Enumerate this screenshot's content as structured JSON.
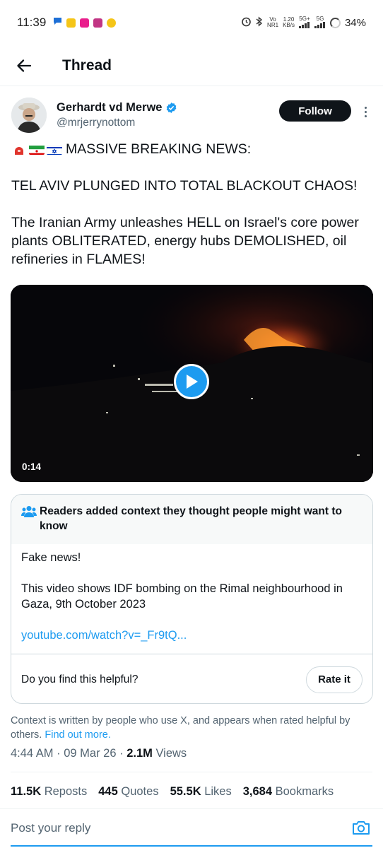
{
  "status_bar": {
    "time": "11:39",
    "network_top": "Vo",
    "network_bottom": "NR1",
    "speed_top": "1.20",
    "speed_bottom": "KB/s",
    "signal1": "5G+",
    "signal2": "5G",
    "battery": "34%"
  },
  "header": {
    "title": "Thread",
    "back_icon": "arrow-left-icon"
  },
  "author": {
    "name": "Gerhardt vd Merwe",
    "handle": "@mrjerrynottom",
    "verified": true,
    "follow_label": "Follow"
  },
  "tweet": {
    "headline": "MASSIVE BREAKING NEWS:",
    "line2": "TEL AVIV PLUNGED INTO TOTAL BLACKOUT CHAOS!",
    "line3": "The Iranian Army unleashes HELL on Israel's core power plants OBLITERATED, energy hubs DEMOLISHED, oil refineries in FLAMES!",
    "emoji_icons": [
      "siren-icon",
      "iran-flag-icon",
      "israel-flag-icon"
    ]
  },
  "video": {
    "duration": "0:14"
  },
  "community_note": {
    "title": "Readers added context they thought people might want to know",
    "line1": "Fake news!",
    "line2": "This video shows IDF bombing on the Rimal neighbourhood in Gaza, 9th October 2023",
    "link": "youtube.com/watch?v=_Fr9tQ...",
    "helpful_question": "Do you find this helpful?",
    "rate_label": "Rate it"
  },
  "context_footer": {
    "text": "Context is written by people who use X, and appears when rated helpful by others.",
    "link": "Find out more."
  },
  "meta": {
    "time": "4:44 AM",
    "date": "09 Mar 26",
    "views_count": "2.1M",
    "views_label": "Views"
  },
  "stats": {
    "reposts_count": "11.5K",
    "reposts_label": "Reposts",
    "quotes_count": "445",
    "quotes_label": "Quotes",
    "likes_count": "55.5K",
    "likes_label": "Likes",
    "bookmarks_count": "3,684",
    "bookmarks_label": "Bookmarks"
  },
  "reply": {
    "placeholder": "Post your reply"
  },
  "colors": {
    "accent": "#1d9bf0",
    "text": "#0f1419",
    "secondary": "#536471",
    "border": "#cfd9de"
  }
}
